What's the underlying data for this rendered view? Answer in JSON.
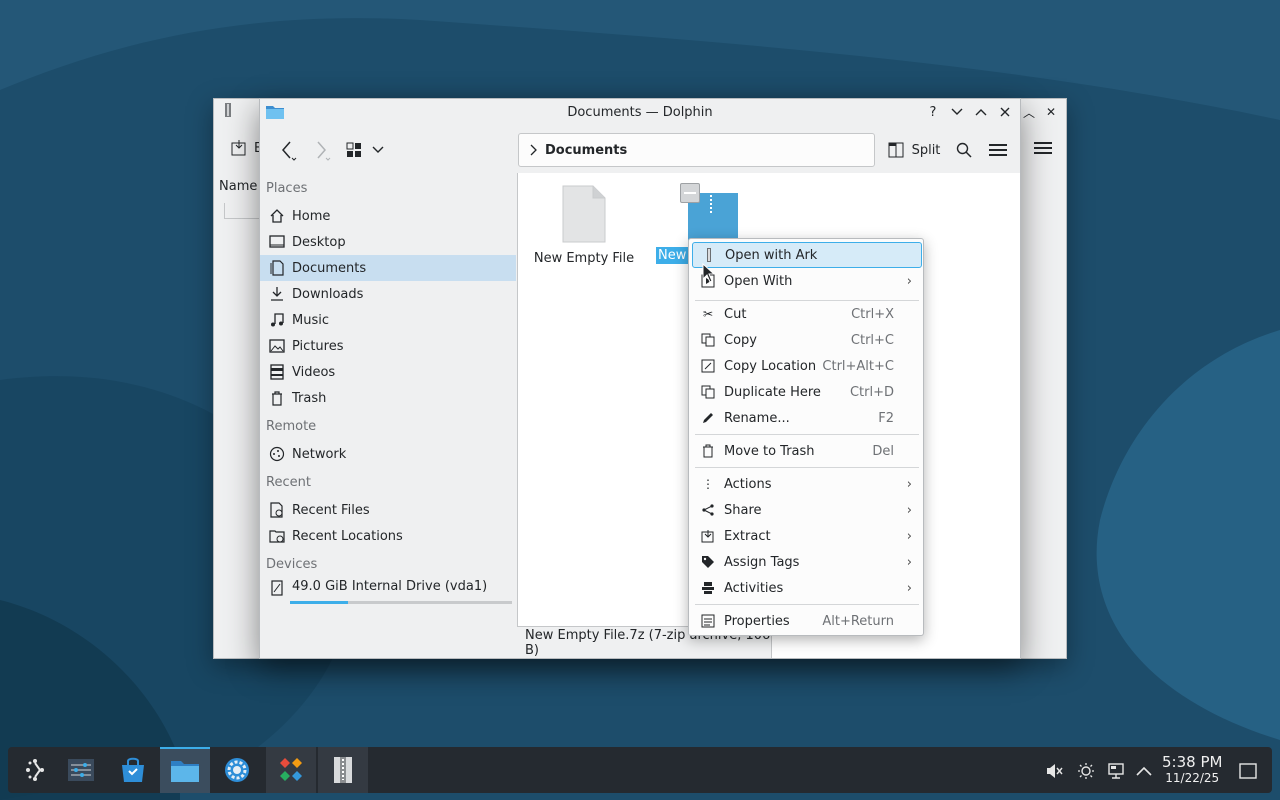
{
  "window": {
    "title": "Documents — Dolphin",
    "back_window_fragment": "E",
    "back_column_header": "Name"
  },
  "toolbar": {
    "location": "Documents",
    "split_label": "Split"
  },
  "places": {
    "sections": [
      {
        "header": "Places",
        "items": [
          "Home",
          "Desktop",
          "Documents",
          "Downloads",
          "Music",
          "Pictures",
          "Videos",
          "Trash"
        ]
      },
      {
        "header": "Remote",
        "items": [
          "Network"
        ]
      },
      {
        "header": "Recent",
        "items": [
          "Recent Files",
          "Recent Locations"
        ]
      },
      {
        "header": "Devices",
        "items": [
          "49.0 GiB Internal Drive (vda1)"
        ]
      }
    ],
    "active": "Documents",
    "drive_usage_fraction": 0.26
  },
  "files": [
    {
      "name": "New Empty File",
      "selected": false
    },
    {
      "name": "New",
      "selected": true
    }
  ],
  "status_text": "New Empty File.7z (7-zip archive, 106 B)",
  "context_menu": {
    "items": [
      {
        "label": "Open with Ark",
        "shortcut": "",
        "submenu": false,
        "icon": "ark-icon",
        "highlighted": true
      },
      {
        "label": "Open With",
        "shortcut": "",
        "submenu": true,
        "icon": "open-with-icon"
      },
      {
        "label": "Cut",
        "shortcut": "Ctrl+X",
        "submenu": false,
        "icon": "cut-icon"
      },
      {
        "label": "Copy",
        "shortcut": "Ctrl+C",
        "submenu": false,
        "icon": "copy-icon"
      },
      {
        "label": "Copy Location",
        "shortcut": "Ctrl+Alt+C",
        "submenu": false,
        "icon": "copy-location-icon"
      },
      {
        "label": "Duplicate Here",
        "shortcut": "Ctrl+D",
        "submenu": false,
        "icon": "duplicate-icon"
      },
      {
        "label": "Rename...",
        "shortcut": "F2",
        "submenu": false,
        "icon": "rename-icon"
      },
      {
        "label": "Move to Trash",
        "shortcut": "Del",
        "submenu": false,
        "icon": "trash-icon"
      },
      {
        "label": "Actions",
        "shortcut": "",
        "submenu": true,
        "icon": "actions-icon"
      },
      {
        "label": "Share",
        "shortcut": "",
        "submenu": true,
        "icon": "share-icon"
      },
      {
        "label": "Extract",
        "shortcut": "",
        "submenu": true,
        "icon": "extract-icon"
      },
      {
        "label": "Assign Tags",
        "shortcut": "",
        "submenu": true,
        "icon": "tag-icon"
      },
      {
        "label": "Activities",
        "shortcut": "",
        "submenu": true,
        "icon": "activities-icon"
      },
      {
        "label": "Properties",
        "shortcut": "Alt+Return",
        "submenu": false,
        "icon": "properties-icon"
      }
    ]
  },
  "taskbar": {
    "time": "5:38 PM",
    "date": "11/22/25",
    "apps": [
      "application-launcher",
      "system-settings-dashboard",
      "discover-store",
      "dolphin-file-manager",
      "system-settings",
      "kde-app",
      "ark-archiver"
    ]
  },
  "colors": {
    "accent": "#3daee9",
    "selection_bg": "#c8def0",
    "wallpaper": "#1d4d6b",
    "taskbar": "#252a30"
  }
}
